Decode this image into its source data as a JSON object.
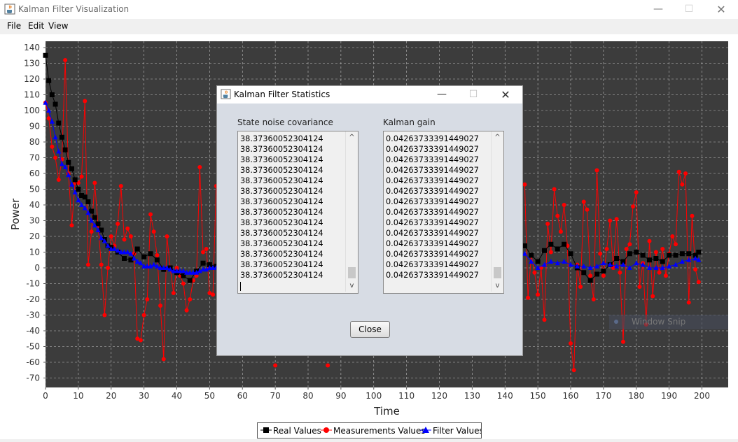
{
  "window": {
    "title": "Kalman Filter Visualization",
    "minimize_glyph": "—",
    "maximize_glyph": "☐",
    "close_glyph": "✕"
  },
  "menu": [
    "File",
    "Edit",
    "View"
  ],
  "colors": {
    "plot_bg": "#3c3c3c",
    "real": "#000000",
    "measurement": "#ff0000",
    "filter": "#0000ff",
    "dialog_bg": "#d7dce4"
  },
  "chart_data": {
    "type": "line",
    "xlabel": "Time",
    "ylabel": "Power",
    "xlim": [
      0,
      208
    ],
    "ylim": [
      -76,
      144
    ],
    "x_ticks": [
      0,
      10,
      20,
      30,
      40,
      50,
      60,
      70,
      80,
      90,
      100,
      110,
      120,
      130,
      140,
      150,
      160,
      170,
      180,
      190,
      200
    ],
    "y_ticks": [
      140,
      130,
      120,
      110,
      100,
      90,
      80,
      70,
      60,
      50,
      40,
      30,
      20,
      10,
      0,
      -10,
      -20,
      -30,
      -40,
      -50,
      -60,
      -70
    ],
    "grid": true,
    "legend_position": "bottom-center",
    "series": [
      {
        "name": "Real Values",
        "marker": "square",
        "color": "#000000",
        "x": [
          0,
          1,
          2,
          3,
          4,
          5,
          6,
          7,
          8,
          9,
          10,
          11,
          12,
          13,
          14,
          15,
          16,
          17,
          18,
          19,
          20,
          22,
          24,
          26,
          28,
          30,
          32,
          34,
          36,
          38,
          40,
          42,
          44,
          46,
          48,
          50,
          52,
          146,
          148,
          150,
          152,
          154,
          156,
          158,
          160,
          162,
          164,
          166,
          168,
          170,
          172,
          174,
          176,
          178,
          180,
          182,
          184,
          186,
          188,
          190,
          192,
          194,
          196,
          198,
          199
        ],
        "y": [
          135,
          119,
          110,
          104,
          92,
          83,
          75,
          67,
          63,
          56,
          50,
          46,
          45,
          42,
          36,
          32,
          28,
          24,
          18,
          14,
          13,
          10,
          6,
          5,
          12,
          7,
          9,
          5,
          -1,
          0,
          -3,
          -5,
          -8,
          -2,
          3,
          2,
          1,
          14,
          8,
          4,
          11,
          15,
          12,
          15,
          9,
          0,
          -3,
          -8,
          -4,
          -2,
          2,
          6,
          4,
          9,
          10,
          8,
          5,
          6,
          4,
          8,
          8,
          9,
          9,
          8,
          10
        ]
      },
      {
        "name": "Measurements Values",
        "marker": "circle",
        "color": "#ff0000",
        "x": [
          0,
          1,
          2,
          3,
          4,
          5,
          6,
          7,
          8,
          9,
          10,
          11,
          12,
          13,
          14,
          15,
          16,
          17,
          18,
          19,
          20,
          21,
          22,
          23,
          24,
          25,
          26,
          27,
          28,
          29,
          30,
          31,
          32,
          33,
          34,
          35,
          36,
          37,
          38,
          39,
          40,
          41,
          42,
          43,
          44,
          45,
          46,
          47,
          48,
          49,
          50,
          51,
          52,
          70,
          86,
          146,
          147,
          148,
          149,
          150,
          151,
          152,
          153,
          154,
          155,
          156,
          157,
          158,
          159,
          160,
          161,
          162,
          163,
          164,
          165,
          166,
          167,
          168,
          169,
          170,
          171,
          172,
          173,
          174,
          175,
          176,
          177,
          178,
          179,
          180,
          181,
          182,
          183,
          184,
          185,
          186,
          187,
          188,
          189,
          190,
          191,
          192,
          193,
          194,
          195,
          196,
          197,
          198,
          199
        ],
        "y": [
          105,
          95,
          77,
          70,
          56,
          69,
          132,
          60,
          27,
          54,
          54,
          58,
          106,
          2,
          23,
          54,
          27,
          2,
          -30,
          0,
          20,
          14,
          28,
          52,
          18,
          25,
          20,
          9,
          -45,
          -46,
          -30,
          -20,
          34,
          23,
          8,
          -24,
          -58,
          20,
          0,
          -16,
          0,
          -5,
          -10,
          -27,
          -20,
          -8,
          -5,
          64,
          10,
          12,
          -16,
          -17,
          52,
          -62,
          -62,
          53,
          -19,
          8,
          -3,
          -17,
          0,
          -33,
          28,
          10,
          50,
          33,
          23,
          40,
          14,
          -48,
          -65,
          2,
          -12,
          42,
          37,
          -5,
          -20,
          62,
          9,
          -5,
          12,
          30,
          0,
          31,
          -3,
          -47,
          12,
          15,
          39,
          48,
          -12,
          3,
          -36,
          17,
          -18,
          10,
          -3,
          12,
          -5,
          9,
          20,
          15,
          61,
          53,
          60,
          -22,
          33,
          -1,
          -9
        ]
      },
      {
        "name": "Filter Values",
        "marker": "triangle",
        "color": "#0000ff",
        "x": [
          0,
          1,
          2,
          3,
          4,
          5,
          6,
          7,
          8,
          9,
          10,
          11,
          12,
          13,
          14,
          15,
          16,
          17,
          18,
          19,
          20,
          21,
          22,
          23,
          24,
          25,
          26,
          27,
          28,
          29,
          30,
          31,
          32,
          33,
          34,
          35,
          36,
          37,
          38,
          39,
          40,
          41,
          42,
          43,
          44,
          45,
          46,
          47,
          48,
          49,
          50,
          51,
          52,
          146,
          148,
          150,
          152,
          154,
          156,
          158,
          160,
          162,
          164,
          166,
          168,
          170,
          172,
          174,
          176,
          178,
          180,
          182,
          184,
          186,
          188,
          190,
          192,
          194,
          196,
          198,
          199
        ],
        "y": [
          105,
          100,
          93,
          83,
          74,
          66,
          64,
          59,
          53,
          48,
          43,
          40,
          38,
          35,
          30,
          27,
          24,
          19,
          17,
          14,
          12,
          12,
          11,
          10,
          10,
          10,
          9,
          6,
          4,
          3,
          1,
          1,
          1,
          2,
          1,
          0,
          0,
          0,
          -1,
          -2,
          -2,
          -2,
          -2,
          -3,
          -3,
          -3,
          -3,
          -2,
          -1,
          -1,
          0,
          0,
          0,
          9,
          4,
          0,
          2,
          4,
          3,
          4,
          2,
          1,
          1,
          0,
          1,
          3,
          2,
          1,
          2,
          0,
          3,
          2,
          0,
          0,
          0,
          1,
          2,
          4,
          5,
          6,
          5
        ]
      }
    ]
  },
  "dialog": {
    "title": "Kalman Filter Statistics",
    "min_glyph": "—",
    "max_glyph": "☐",
    "close_glyph": "✕",
    "left_label": "State noise covariance",
    "right_label": "Kalman gain",
    "left_lines": [
      "38.37360052304124",
      "38.37360052304124",
      "38.37360052304124",
      "38.37360052304124",
      "38.37360052304124",
      "38.37360052304124",
      "38.37360052304124",
      "38.37360052304124",
      "38.37360052304124",
      "38.37360052304124",
      "38.37360052304124",
      "38.37360052304124",
      "38.37360052304124",
      "38.37360052304124"
    ],
    "right_lines": [
      "0.04263733391449027",
      "0.04263733391449027",
      "0.04263733391449027",
      "0.04263733391449027",
      "0.04263733391449027",
      "0.04263733391449027",
      "0.04263733391449027",
      "0.04263733391449027",
      "0.04263733391449027",
      "0.04263733391449027",
      "0.04263733391449027",
      "0.04263733391449027",
      "0.04263733391449027",
      "0.04263733391449027"
    ],
    "close_label": "Close",
    "scroll_up": "^",
    "scroll_down": "v"
  },
  "overlay": {
    "snip_text": "Window Snip"
  }
}
